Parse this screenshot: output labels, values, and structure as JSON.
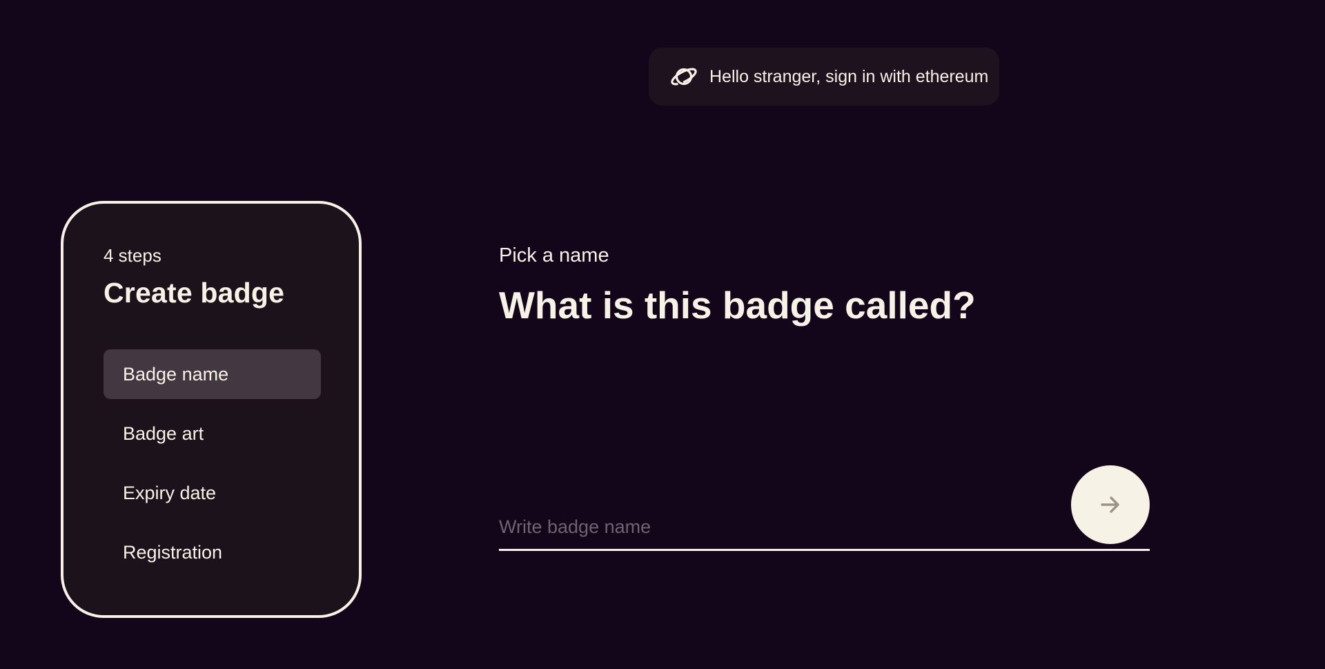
{
  "header": {
    "signin_text": "Hello stranger, sign in with ethereum",
    "signin_icon": "planet-icon"
  },
  "steps_card": {
    "count_label": "4 steps",
    "title": "Create badge",
    "active_index": 0,
    "items": [
      {
        "label": "Badge name"
      },
      {
        "label": "Badge art"
      },
      {
        "label": "Expiry date"
      },
      {
        "label": "Registration"
      }
    ]
  },
  "main": {
    "section_label": "Pick a name",
    "question": "What is this badge called?",
    "input": {
      "value": "",
      "placeholder": "Write badge name"
    },
    "next_icon": "arrow-right-icon"
  },
  "colors": {
    "background": "#13061a",
    "card": "#1b121c",
    "text": "#f7f2e6",
    "active_step": "#433841",
    "placeholder": "#6e6470",
    "arrow": "#9b9486"
  }
}
